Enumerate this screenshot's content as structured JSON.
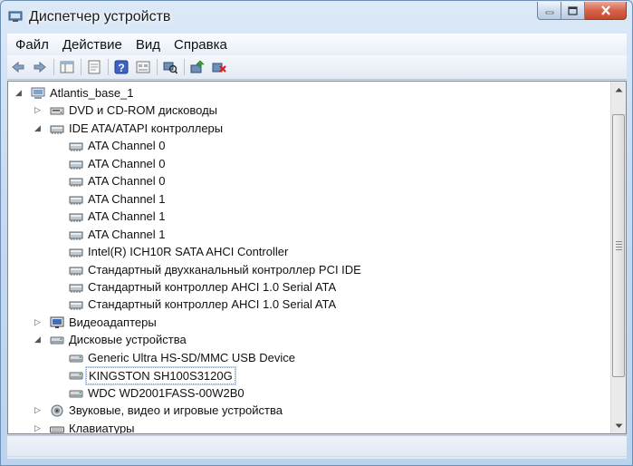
{
  "window": {
    "title": "Диспетчер устройств"
  },
  "menu": [
    {
      "label": "Файл"
    },
    {
      "label": "Действие"
    },
    {
      "label": "Вид"
    },
    {
      "label": "Справка"
    }
  ],
  "toolbar": {
    "buttons": [
      "back-icon",
      "forward-icon",
      "show-hide-tree-icon",
      "properties-icon",
      "help-icon",
      "view-icon",
      "scan-hardware-icon",
      "update-driver-icon",
      "uninstall-icon"
    ]
  },
  "tree": [
    {
      "label": "Atlantis_base_1",
      "level": 0,
      "expander": "expanded",
      "icon": "computer-icon"
    },
    {
      "label": "DVD и CD-ROM дисководы",
      "level": 1,
      "expander": "collapsed",
      "icon": "dvd-drive-icon"
    },
    {
      "label": "IDE ATA/ATAPI контроллеры",
      "level": 1,
      "expander": "expanded",
      "icon": "ide-controller-icon"
    },
    {
      "label": "ATA Channel 0",
      "level": 2,
      "expander": "none",
      "icon": "ide-controller-icon"
    },
    {
      "label": "ATA Channel 0",
      "level": 2,
      "expander": "none",
      "icon": "ide-controller-icon"
    },
    {
      "label": "ATA Channel 0",
      "level": 2,
      "expander": "none",
      "icon": "ide-controller-icon"
    },
    {
      "label": "ATA Channel 1",
      "level": 2,
      "expander": "none",
      "icon": "ide-controller-icon"
    },
    {
      "label": "ATA Channel 1",
      "level": 2,
      "expander": "none",
      "icon": "ide-controller-icon"
    },
    {
      "label": "ATA Channel 1",
      "level": 2,
      "expander": "none",
      "icon": "ide-controller-icon"
    },
    {
      "label": "Intel(R) ICH10R SATA AHCI Controller",
      "level": 2,
      "expander": "none",
      "icon": "ide-controller-icon"
    },
    {
      "label": "Стандартный двухканальный контроллер PCI IDE",
      "level": 2,
      "expander": "none",
      "icon": "ide-controller-icon"
    },
    {
      "label": "Стандартный контроллер AHCI 1.0 Serial ATA",
      "level": 2,
      "expander": "none",
      "icon": "ide-controller-icon"
    },
    {
      "label": "Стандартный контроллер AHCI 1.0 Serial ATA",
      "level": 2,
      "expander": "none",
      "icon": "ide-controller-icon"
    },
    {
      "label": "Видеоадаптеры",
      "level": 1,
      "expander": "collapsed",
      "icon": "display-adapter-icon"
    },
    {
      "label": "Дисковые устройства",
      "level": 1,
      "expander": "expanded",
      "icon": "disk-drive-icon"
    },
    {
      "label": "Generic Ultra HS-SD/MMC USB Device",
      "level": 2,
      "expander": "none",
      "icon": "disk-drive-icon"
    },
    {
      "label": "KINGSTON SH100S3120G",
      "level": 2,
      "expander": "none",
      "icon": "disk-drive-icon",
      "selected": true
    },
    {
      "label": "WDC WD2001FASS-00W2B0",
      "level": 2,
      "expander": "none",
      "icon": "disk-drive-icon"
    },
    {
      "label": "Звуковые, видео и игровые устройства",
      "level": 1,
      "expander": "collapsed",
      "icon": "speaker-icon"
    },
    {
      "label": "Клавиатуры",
      "level": 1,
      "expander": "collapsed",
      "icon": "keyboard-icon"
    }
  ],
  "colors": {
    "title_bar": "#c7dbf1",
    "close_button": "#d7624a",
    "selection_border": "#7a96c4"
  }
}
